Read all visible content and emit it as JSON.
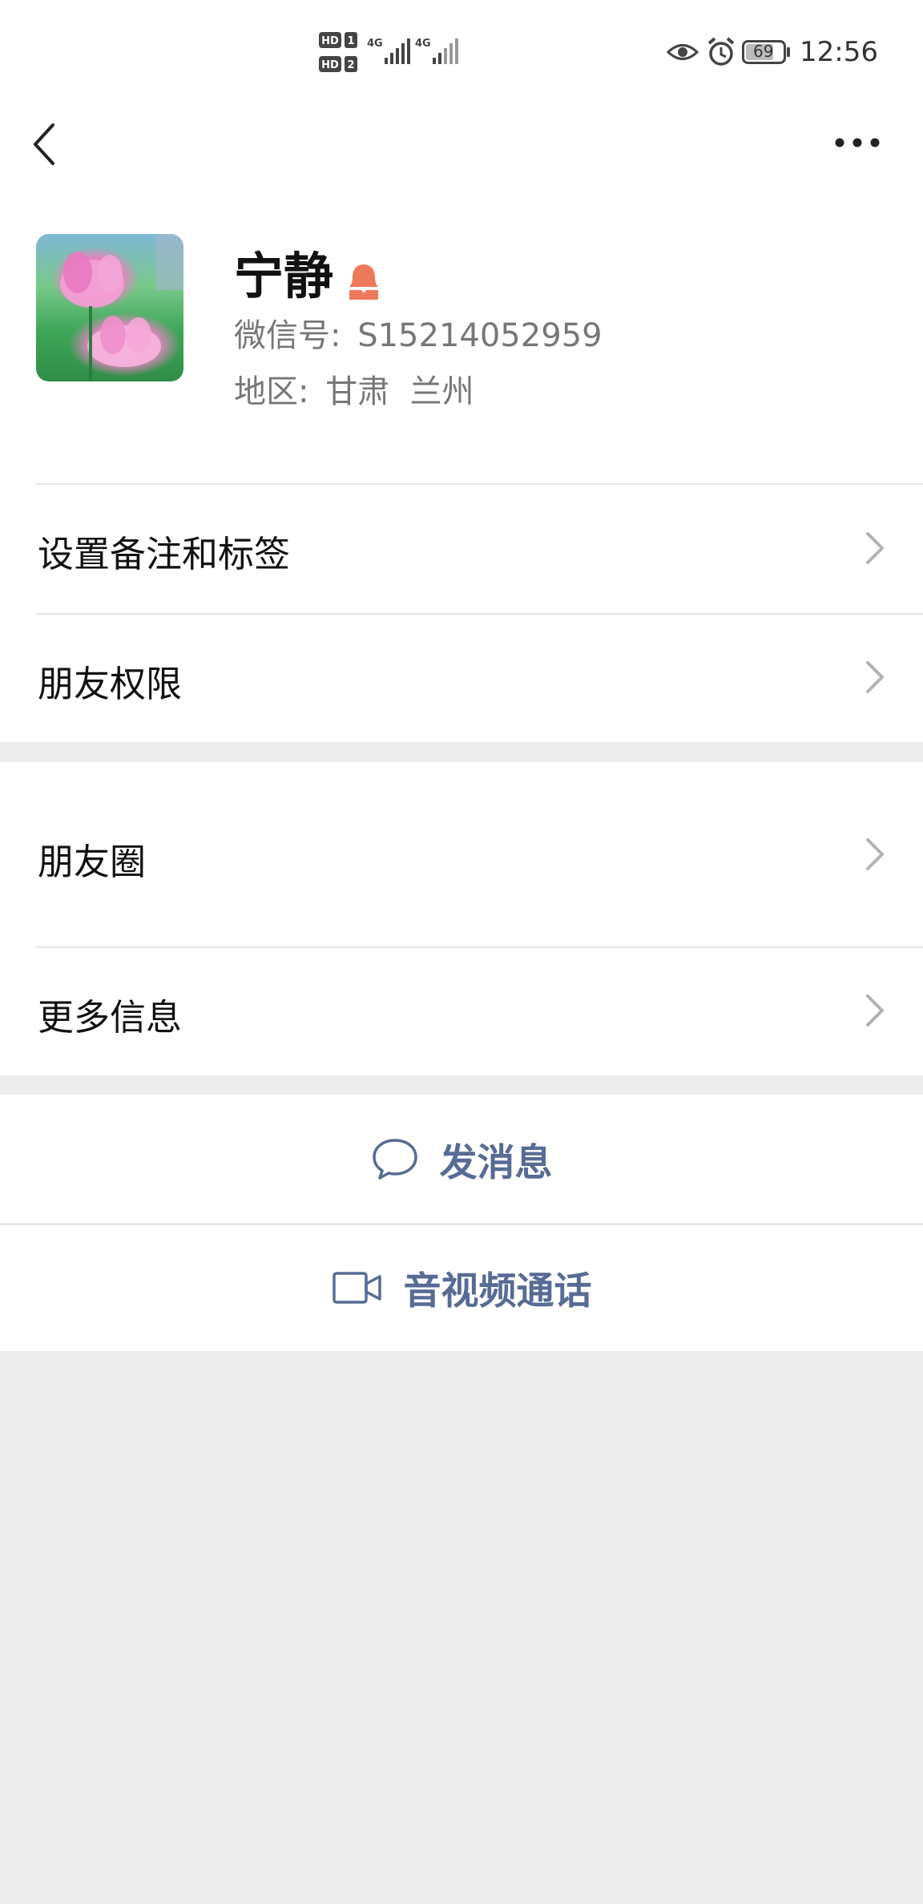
{
  "status_bar": {
    "time": "12:56",
    "battery": "69",
    "sim1": "HD 1",
    "sim2": "HD 2",
    "network": "4G"
  },
  "nav": {
    "back_icon": "back-chevron-icon",
    "more_icon": "more-dots-icon"
  },
  "profile": {
    "name": "宁静",
    "gender_icon": "female-icon",
    "wechat_id_label": "微信号:",
    "wechat_id": "S15214052959",
    "region_label": "地区:",
    "region": "甘肃  兰州"
  },
  "rows": {
    "remark_tags": "设置备注和标签",
    "friend_permissions": "朋友权限",
    "moments": "朋友圈",
    "more_info": "更多信息"
  },
  "actions": {
    "send_message": "发消息",
    "video_call": "音视频通话"
  },
  "colors": {
    "accent_link": "#576b95",
    "gender_female": "#ee7a5b",
    "background": "#ededed"
  }
}
